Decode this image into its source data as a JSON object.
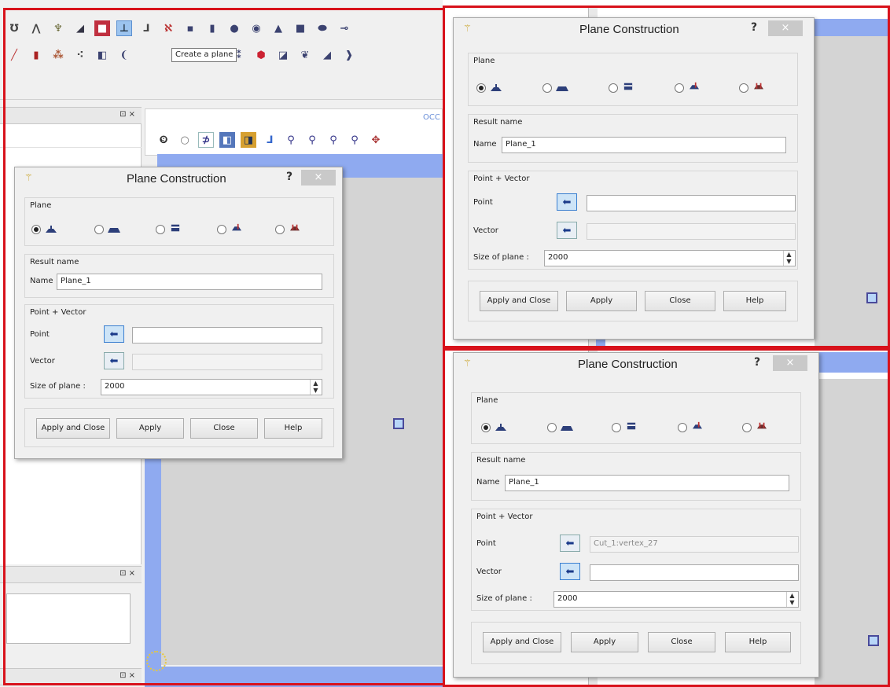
{
  "tooltip": "Create a plane",
  "viewer_tag": "OCC",
  "dialogs": [
    {
      "title": "Plane Construction",
      "help_glyph": "?",
      "close_glyph": "×",
      "plane_label": "Plane",
      "result_label": "Result name",
      "name_label": "Name",
      "name_value": "Plane_1",
      "method_label": "Point + Vector",
      "point_label": "Point",
      "point_value": "",
      "vector_label": "Vector",
      "vector_value": "",
      "size_label": "Size of plane :",
      "size_value": "2000",
      "buttons": [
        "Apply and Close",
        "Apply",
        "Close",
        "Help"
      ]
    },
    {
      "title": "Plane Construction",
      "help_glyph": "?",
      "close_glyph": "×",
      "plane_label": "Plane",
      "result_label": "Result name",
      "name_label": "Name",
      "name_value": "Plane_1",
      "method_label": "Point + Vector",
      "point_label": "Point",
      "point_value": "",
      "vector_label": "Vector",
      "vector_value": "",
      "size_label": "Size of plane :",
      "size_value": "2000",
      "buttons": [
        "Apply and Close",
        "Apply",
        "Close",
        "Help"
      ]
    },
    {
      "title": "Plane Construction",
      "help_glyph": "?",
      "close_glyph": "×",
      "plane_label": "Plane",
      "result_label": "Result name",
      "name_label": "Name",
      "name_value": "Plane_1",
      "method_label": "Point + Vector",
      "point_label": "Point",
      "point_value": "Cut_1:vertex_27",
      "vector_label": "Vector",
      "vector_value": "",
      "size_label": "Size of plane :",
      "size_value": "2000",
      "buttons": [
        "Apply and Close",
        "Apply",
        "Close",
        "Help"
      ]
    }
  ],
  "dock_close": "⊡ ×",
  "colors": {
    "frame": "#d8121b",
    "view_blue": "#8faaf0",
    "view_bg": "#d4d4d4"
  }
}
